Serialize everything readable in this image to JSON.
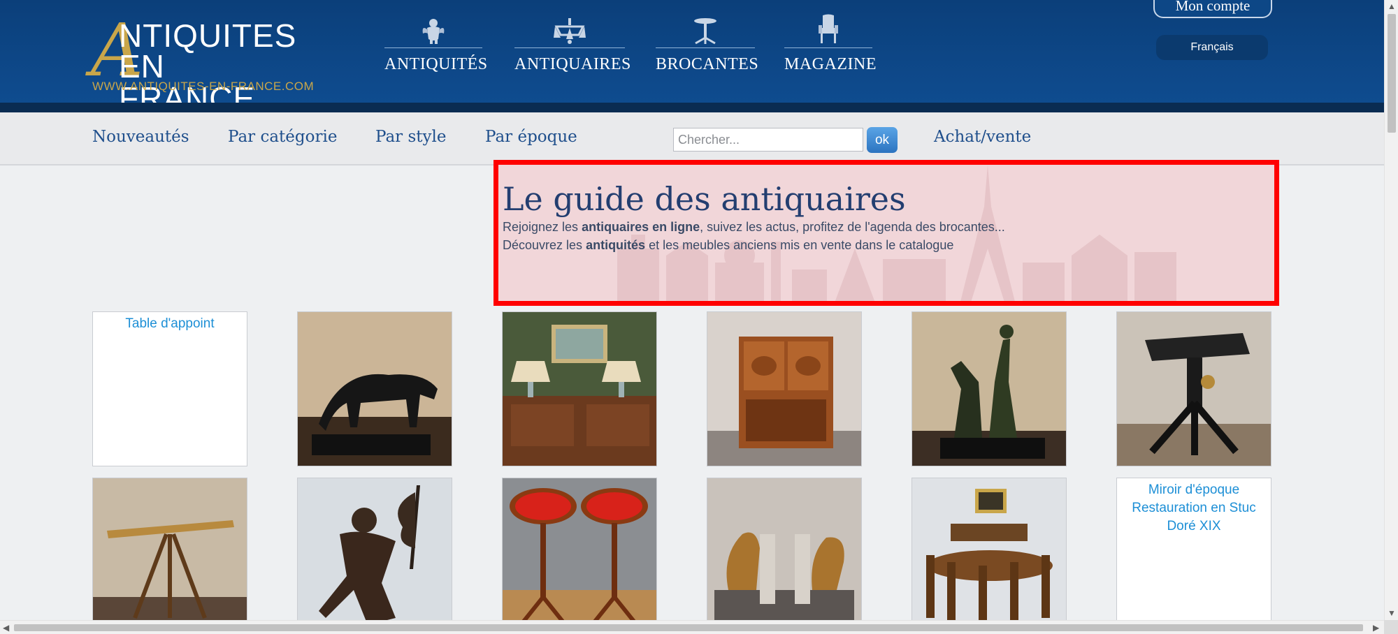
{
  "logo": {
    "big_letter": "A",
    "line1": "NTIQUITES",
    "line2": "EN FRANCE",
    "url": "WWW.ANTIQUITES-EN-FRANCE.COM"
  },
  "topnav": [
    {
      "label": "ANTIQUITÉS",
      "icon": "cherub-icon"
    },
    {
      "label": "ANTIQUAIRES",
      "icon": "chandelier-icon"
    },
    {
      "label": "BROCANTES",
      "icon": "pedestal-table-icon"
    },
    {
      "label": "MAGAZINE",
      "icon": "armchair-icon"
    }
  ],
  "account": {
    "label": "Mon compte",
    "language": "Français"
  },
  "subnav": {
    "links": [
      "Nouveautés",
      "Par catégorie",
      "Par style",
      "Par époque"
    ],
    "search_placeholder": "Chercher...",
    "ok_label": "ok",
    "achat_vente": "Achat/vente"
  },
  "hero": {
    "title": "Le guide des antiquaires",
    "line1_pre": "Rejoignez les ",
    "line1_bold": "antiquaires en ligne",
    "line1_post": ", suivez les actus, profitez de l'agenda des brocantes...",
    "line2_pre": "Découvrez les ",
    "line2_bold": "antiquités",
    "line2_post": " et les meubles anciens mis en vente dans le catalogue"
  },
  "products": [
    {
      "alt": "Table d'appoint",
      "broken": true
    },
    {
      "image": "panther-sculpture"
    },
    {
      "image": "sideboard-lamps"
    },
    {
      "image": "wooden-cabinet"
    },
    {
      "image": "bronze-figure-deer"
    },
    {
      "image": "iron-table"
    },
    {
      "image": "brass-telescope"
    },
    {
      "image": "bronze-flag-statue"
    },
    {
      "image": "red-pedestal-tables"
    },
    {
      "image": "bird-bookends"
    },
    {
      "image": "dining-set"
    },
    {
      "alt": "Miroir d'époque Restauration en Stuc Doré XIX",
      "broken": true
    }
  ],
  "colors": {
    "header_blue": "#0f4d91",
    "gold": "#c9a64a",
    "link_blue": "#1f4f8c",
    "highlight_red": "#ff0000"
  }
}
